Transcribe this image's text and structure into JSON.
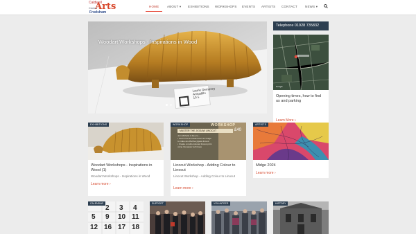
{
  "logo": {
    "line1": "Caldwell",
    "line2": "Arts",
    "line3": "Centre",
    "line4": "Frodsham"
  },
  "nav": [
    {
      "label": "HOME",
      "active": true
    },
    {
      "label": "ABOUT ▾"
    },
    {
      "label": "EXHIBITIONS"
    },
    {
      "label": "WORKSHOPS"
    },
    {
      "label": "EVENTS"
    },
    {
      "label": "ARTISTS"
    },
    {
      "label": "CONTACT"
    },
    {
      "label": "NEWS ▾"
    }
  ],
  "hero": {
    "caption": "Woodart Workshops - Inspirations in Wood",
    "plaque_line1": "Laurie Dempsey",
    "plaque_line2": "Armadillo",
    "plaque_line3": "10 5"
  },
  "sidebar": {
    "phone": "Telephone 01928 735832",
    "map_text": "Opening times, how to find us and parking",
    "more": "Learn More"
  },
  "cards": [
    {
      "tag": "EXHIBITIONS",
      "title": "Woodart Workshops - Inspirations in Wood (1)",
      "excerpt": "Woodart Workshops - Inspirations in Wood",
      "more": "Learn more"
    },
    {
      "tag": "WORKSHOP",
      "title": "Linocut Workshop - Adding Colour to Linocut",
      "excerpt": "Linocut Workshop - Adding Colour to Linocut",
      "more": "Learn more",
      "poster_head": "WORKSHOP",
      "poster_title": "MASTER THE JIGSAW LINOCUT",
      "poster_price": "£40",
      "poster_lines": [
        "Join Michelle & Dee to...",
        "• Learn how to break down an image",
        "  to make an effective jigsaw linocut",
        "• Create a multi-coloured linocut print",
        "  using the jigsaw technique"
      ]
    },
    {
      "tag": "ARTISTS",
      "title": "Midge 2024",
      "excerpt": "",
      "more": "Learn more"
    }
  ],
  "bottom": [
    {
      "tag": "CALENDAR",
      "digits": [
        "2",
        "3",
        "4",
        "5",
        "9",
        "10",
        "11",
        "12",
        "16",
        "17",
        "18"
      ]
    },
    {
      "tag": "SUPPORT"
    },
    {
      "tag": "VOLUNTEER"
    },
    {
      "tag": "HISTORY"
    }
  ],
  "colors": {
    "accent": "#d64a2f",
    "dark": "#2c3e50",
    "bg": "#ececec"
  }
}
